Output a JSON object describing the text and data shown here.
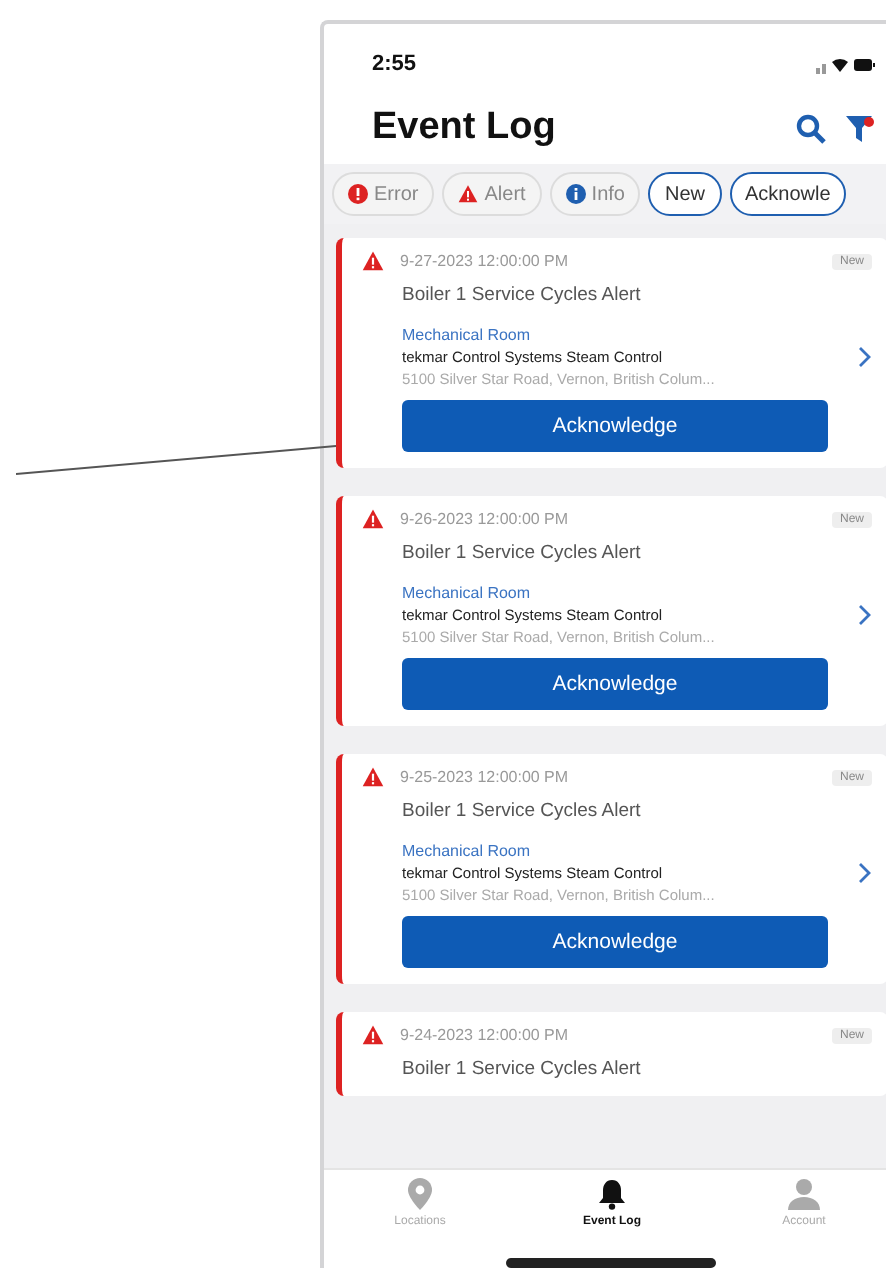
{
  "status_bar": {
    "time": "2:55"
  },
  "header": {
    "title": "Event Log"
  },
  "filters": [
    {
      "kind": "error",
      "label": "Error",
      "selected": false
    },
    {
      "kind": "alert",
      "label": "Alert",
      "selected": false
    },
    {
      "kind": "info",
      "label": "Info",
      "selected": false
    },
    {
      "kind": "plain",
      "label": "New",
      "selected": true
    },
    {
      "kind": "plain",
      "label": "Acknowle",
      "selected": true
    }
  ],
  "events": [
    {
      "kind": "alert",
      "date": "9-27-2023 12:00:00 PM",
      "badge": "New",
      "title": "Boiler 1 Service Cycles Alert",
      "room": "Mechanical Room",
      "system": "tekmar Control Systems Steam Control",
      "address": "5100 Silver Star Road, Vernon, British Colum...",
      "action": "Acknowledge"
    },
    {
      "kind": "alert",
      "date": "9-26-2023 12:00:00 PM",
      "badge": "New",
      "title": "Boiler 1 Service Cycles Alert",
      "room": "Mechanical Room",
      "system": "tekmar Control Systems Steam Control",
      "address": "5100 Silver Star Road, Vernon, British Colum...",
      "action": "Acknowledge"
    },
    {
      "kind": "alert",
      "date": "9-25-2023 12:00:00 PM",
      "badge": "New",
      "title": "Boiler 1 Service Cycles Alert",
      "room": "Mechanical Room",
      "system": "tekmar Control Systems Steam Control",
      "address": "5100 Silver Star Road, Vernon, British Colum...",
      "action": "Acknowledge"
    },
    {
      "kind": "alert",
      "date": "9-24-2023 12:00:00 PM",
      "badge": "New",
      "title": "Boiler 1 Service Cycles Alert"
    }
  ],
  "tab_bar": [
    {
      "kind": "pin",
      "label": "Locations",
      "selected": false
    },
    {
      "kind": "bell",
      "label": "Event Log",
      "selected": true
    },
    {
      "kind": "person",
      "label": "Account",
      "selected": false
    }
  ]
}
